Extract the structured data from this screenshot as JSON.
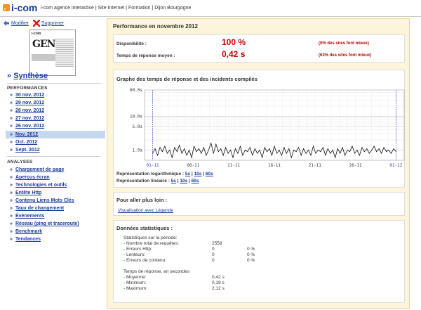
{
  "header": {
    "logo": "i-com",
    "tagline": "i-com agence interactive | Site Internet | Formation | Dijon Bourgogne"
  },
  "sidebar": {
    "modify_label": "Modifier",
    "delete_label": "Supprimer",
    "thumb_logo": "i-com",
    "thumb_word": "GENI",
    "synthese_label": "Synthèse",
    "performances_title": "PERFORMANCES",
    "days": [
      "30 nov. 2012",
      "29 nov. 2012",
      "28 nov. 2012",
      "27 nov. 2012",
      "26 nov. 2012"
    ],
    "months": [
      "Nov. 2012",
      "Oct. 2012",
      "Sept. 2012"
    ],
    "analyses_title": "ANALYSES",
    "analyses": [
      "Chargement de page",
      "Aperçus écran",
      "Technologies et outils",
      "Entête Http",
      "Contenu Liens Mots Clés",
      "Taux de changement",
      "Évènements",
      "Réseau (ping et traceroute)",
      "Benchmark",
      "Tendances"
    ]
  },
  "main": {
    "title": "Performance en novembre 2012",
    "dispo_label": "Disponibilité :",
    "dispo_value": "100 %",
    "dispo_note": "(0% des sites font mieux)",
    "resp_label": "Temps de réponse moyen :",
    "resp_value": "0,42 s",
    "resp_note": "(63% des sites font mieux)",
    "graph_title": "Graphe des temps de réponse et des incidents compilés",
    "repr_log_label": "Représentation logarithmique :",
    "repr_lin_label": "Représentation linéaire :",
    "repr_links": [
      "5s",
      "10s",
      "60s"
    ],
    "further_title": "Pour aller plus loin :",
    "further_link": "Visualisation avec Légende",
    "data_title": "Données statistiques :",
    "stats": {
      "period_title": "Statistiques sur la période:",
      "rows": [
        {
          "label": "- Nombre total de requêtes:",
          "value": "2558",
          "pct": ""
        },
        {
          "label": "- Erreurs Http:",
          "value": "0",
          "pct": "0 %"
        },
        {
          "label": "- Lenteurs:",
          "value": "0",
          "pct": "0 %"
        },
        {
          "label": "- Erreurs de contenu:",
          "value": "0",
          "pct": "0 %"
        }
      ],
      "resp_title": "Temps de réponse, en secondes",
      "resp_rows": [
        {
          "label": "- Moyenne:",
          "value": "0,42 s"
        },
        {
          "label": "- Minimum:",
          "value": "0,19 s"
        },
        {
          "label": "- Maximum:",
          "value": "2,12 s"
        }
      ]
    }
  },
  "chart_data": {
    "type": "line",
    "y_scale": "log",
    "y_tick_labels": [
      "60.0s",
      "10.0s",
      "5.0s",
      "1.0s"
    ],
    "y_ticks": [
      60,
      10,
      5,
      1
    ],
    "x_tick_labels": [
      "01-11",
      "06-11",
      "11-11",
      "16-11",
      "21-11",
      "26-11",
      "01-12"
    ],
    "x_ticks": [
      1,
      6,
      11,
      16,
      21,
      26,
      31
    ],
    "xlim": [
      0,
      32
    ],
    "ylim": [
      0.5,
      60
    ],
    "grid": true,
    "series": [
      {
        "values": [
          [
            1.0,
            0.8
          ],
          [
            1.3,
            1.1
          ],
          [
            1.6,
            0.7
          ],
          [
            1.9,
            1.2
          ],
          [
            2.2,
            0.9
          ],
          [
            2.5,
            1.3
          ],
          [
            2.8,
            0.8
          ],
          [
            3.1,
            1.0
          ],
          [
            3.4,
            0.6
          ],
          [
            3.7,
            1.2
          ],
          [
            4.0,
            0.9
          ],
          [
            4.3,
            1.4
          ],
          [
            4.6,
            0.8
          ],
          [
            4.9,
            1.1
          ],
          [
            5.2,
            0.7
          ],
          [
            5.5,
            1.0
          ],
          [
            5.8,
            0.6
          ],
          [
            6.1,
            1.3
          ],
          [
            6.4,
            0.9
          ],
          [
            6.7,
            1.1
          ],
          [
            7.0,
            0.8
          ],
          [
            7.3,
            1.2
          ],
          [
            7.6,
            0.7
          ],
          [
            7.9,
            1.0
          ],
          [
            8.2,
            1.6
          ],
          [
            8.5,
            0.8
          ],
          [
            8.8,
            1.5
          ],
          [
            9.1,
            0.9
          ],
          [
            9.4,
            1.1
          ],
          [
            9.7,
            0.7
          ],
          [
            10.0,
            1.2
          ],
          [
            10.3,
            0.8
          ],
          [
            10.6,
            1.0
          ],
          [
            10.9,
            0.6
          ],
          [
            11.2,
            1.1
          ],
          [
            11.5,
            0.8
          ],
          [
            11.8,
            1.3
          ],
          [
            12.1,
            0.7
          ],
          [
            12.4,
            1.0
          ],
          [
            12.7,
            0.9
          ],
          [
            13.0,
            1.2
          ],
          [
            13.3,
            0.7
          ],
          [
            13.6,
            1.1
          ],
          [
            13.9,
            0.8
          ],
          [
            14.2,
            1.0
          ],
          [
            14.5,
            0.6
          ],
          [
            14.8,
            1.2
          ],
          [
            15.1,
            0.9
          ],
          [
            15.4,
            1.1
          ],
          [
            15.7,
            0.7
          ],
          [
            16.0,
            1.3
          ],
          [
            16.3,
            0.8
          ],
          [
            16.6,
            1.0
          ],
          [
            16.9,
            0.7
          ],
          [
            17.2,
            1.2
          ],
          [
            17.5,
            0.8
          ],
          [
            17.8,
            1.1
          ],
          [
            18.1,
            0.6
          ],
          [
            18.4,
            1.0
          ],
          [
            18.7,
            0.9
          ],
          [
            19.0,
            1.2
          ],
          [
            19.3,
            0.7
          ],
          [
            19.6,
            1.1
          ],
          [
            19.9,
            0.8
          ],
          [
            20.2,
            1.0
          ],
          [
            20.5,
            0.7
          ],
          [
            20.8,
            1.3
          ],
          [
            21.1,
            0.8
          ],
          [
            21.4,
            1.0
          ],
          [
            21.7,
            0.9
          ],
          [
            22.0,
            1.2
          ],
          [
            22.3,
            0.7
          ],
          [
            22.6,
            1.1
          ],
          [
            22.9,
            0.8
          ],
          [
            23.2,
            1.0
          ],
          [
            23.5,
            0.6
          ],
          [
            23.8,
            1.1
          ],
          [
            24.1,
            0.8
          ],
          [
            24.4,
            1.2
          ],
          [
            24.7,
            0.7
          ],
          [
            25.0,
            1.0
          ],
          [
            25.3,
            0.9
          ],
          [
            25.6,
            1.3
          ],
          [
            25.9,
            0.8
          ],
          [
            26.2,
            1.0
          ],
          [
            26.5,
            0.7
          ],
          [
            26.8,
            1.2
          ],
          [
            27.1,
            0.9
          ],
          [
            27.4,
            1.1
          ],
          [
            27.7,
            0.8
          ],
          [
            28.0,
            1.0
          ],
          [
            28.3,
            1.3
          ],
          [
            28.6,
            0.9
          ],
          [
            28.9,
            1.1
          ],
          [
            29.2,
            0.8
          ],
          [
            29.5,
            1.2
          ],
          [
            29.8,
            0.9
          ],
          [
            30.1,
            1.0
          ],
          [
            30.4,
            0.8
          ],
          [
            30.7,
            1.1
          ],
          [
            31.0,
            0.9
          ]
        ]
      }
    ],
    "vertical_markers": [
      1,
      31
    ]
  }
}
